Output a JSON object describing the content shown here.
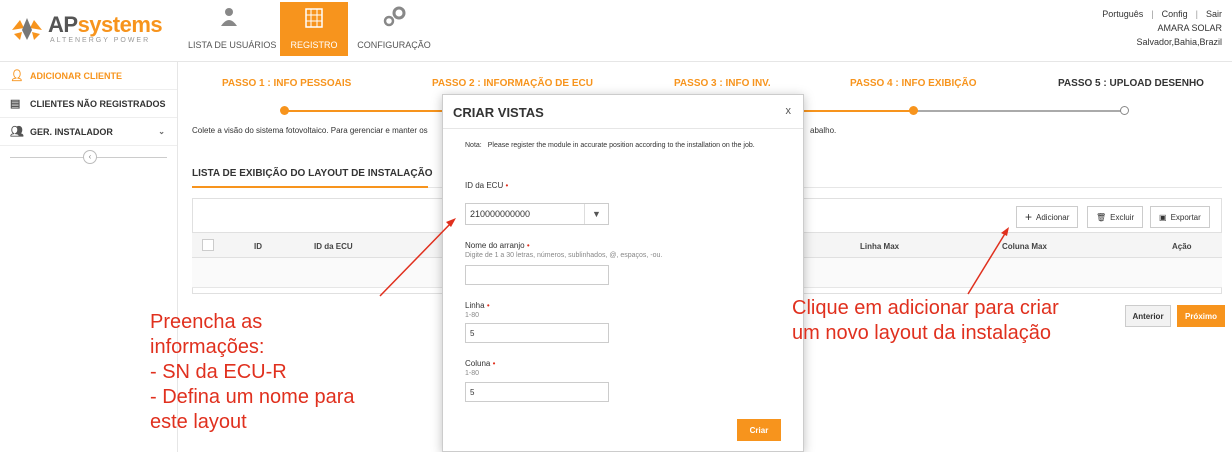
{
  "brand": {
    "name_prefix": "AP",
    "name_suffix": "systems",
    "tagline": "ALTENERGY POWER"
  },
  "nav": {
    "users": "LISTA DE USUÁRIOS",
    "register": "REGISTRO",
    "config": "CONFIGURAÇÃO"
  },
  "topright": {
    "language": "Português",
    "config": "Config",
    "logout": "Sair",
    "account": "AMARA SOLAR",
    "location": "Salvador,Bahia,Brazil"
  },
  "sidebar": {
    "items": [
      {
        "label": "ADICIONAR CLIENTE"
      },
      {
        "label": "CLIENTES NÃO REGISTRADOS"
      },
      {
        "label": "GER. INSTALADOR"
      }
    ]
  },
  "steps": [
    "PASSO 1 : INFO PESSOAIS",
    "PASSO 2 : INFORMAÇÃO DE ECU",
    "PASSO 3 : INFO INV.",
    "PASSO 4 : INFO EXIBIÇÃO",
    "PASSO 5 : UPLOAD DESENHO"
  ],
  "description_left": "Colete a visão do sistema fotovoltaico. Para gerenciar e manter os",
  "description_right": "abalho.",
  "section_title": "LISTA DE EXIBIÇÃO DO LAYOUT DE INSTALAÇÃO",
  "toolbar": {
    "add": "Adicionar",
    "delete": "Excluir",
    "export": "Exportar"
  },
  "table": {
    "columns": [
      "ID",
      "ID da ECU",
      "Linha Max",
      "Coluna Max",
      "Ação"
    ]
  },
  "buttons": {
    "previous": "Anterior",
    "next": "Próximo"
  },
  "modal": {
    "title": "CRIAR VISTAS",
    "close": "x",
    "note_label": "Nota:",
    "note_text": "Please register the module in accurate position according to the installation on the job.",
    "ecu_label": "ID da ECU",
    "ecu_value": "210000000000",
    "array_label": "Nome do arranjo",
    "array_hint": "Digite de 1 a 30 letras, números, sublinhados, @, espaços, -ou.",
    "array_value": "",
    "row_label": "Linha",
    "row_hint": "1-80",
    "row_value": "5",
    "col_label": "Coluna",
    "col_hint": "1-80",
    "col_value": "5",
    "create": "Criar"
  },
  "annotations": {
    "left": [
      "Preencha as",
      "informações:",
      "- SN da ECU-R",
      "- Defina um nome para",
      "este layout"
    ],
    "right": [
      "Clique em adicionar para criar",
      "um novo layout da instalação"
    ]
  },
  "colors": {
    "accent": "#f7941d",
    "annotation": "#e0301e"
  }
}
